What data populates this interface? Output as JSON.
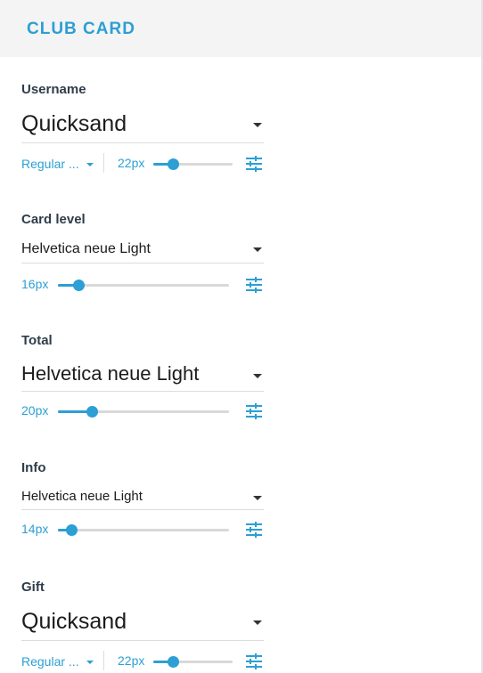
{
  "header": {
    "title": "CLUB CARD"
  },
  "colors": {
    "accent": "#2c9fd4",
    "label": "#2f3d4a",
    "header_bg": "#f4f4f4"
  },
  "fields": [
    {
      "label": "Username",
      "font": "Quicksand",
      "weight": "Regular ...",
      "size": "22px",
      "slider_fraction": 0.25,
      "icon": "tune-icon"
    },
    {
      "label": "Card level",
      "font": "Helvetica neue Light",
      "size": "16px",
      "slider_fraction": 0.12,
      "icon": "tune-icon"
    },
    {
      "label": "Total",
      "font": "Helvetica neue Light",
      "size": "20px",
      "slider_fraction": 0.2,
      "icon": "tune-icon"
    },
    {
      "label": "Info",
      "font": "Helvetica neue Light",
      "size": "14px",
      "slider_fraction": 0.08,
      "icon": "tune-icon"
    },
    {
      "label": "Gift",
      "font": "Quicksand",
      "weight": "Regular ...",
      "size": "22px",
      "slider_fraction": 0.25,
      "icon": "tune-icon"
    }
  ]
}
